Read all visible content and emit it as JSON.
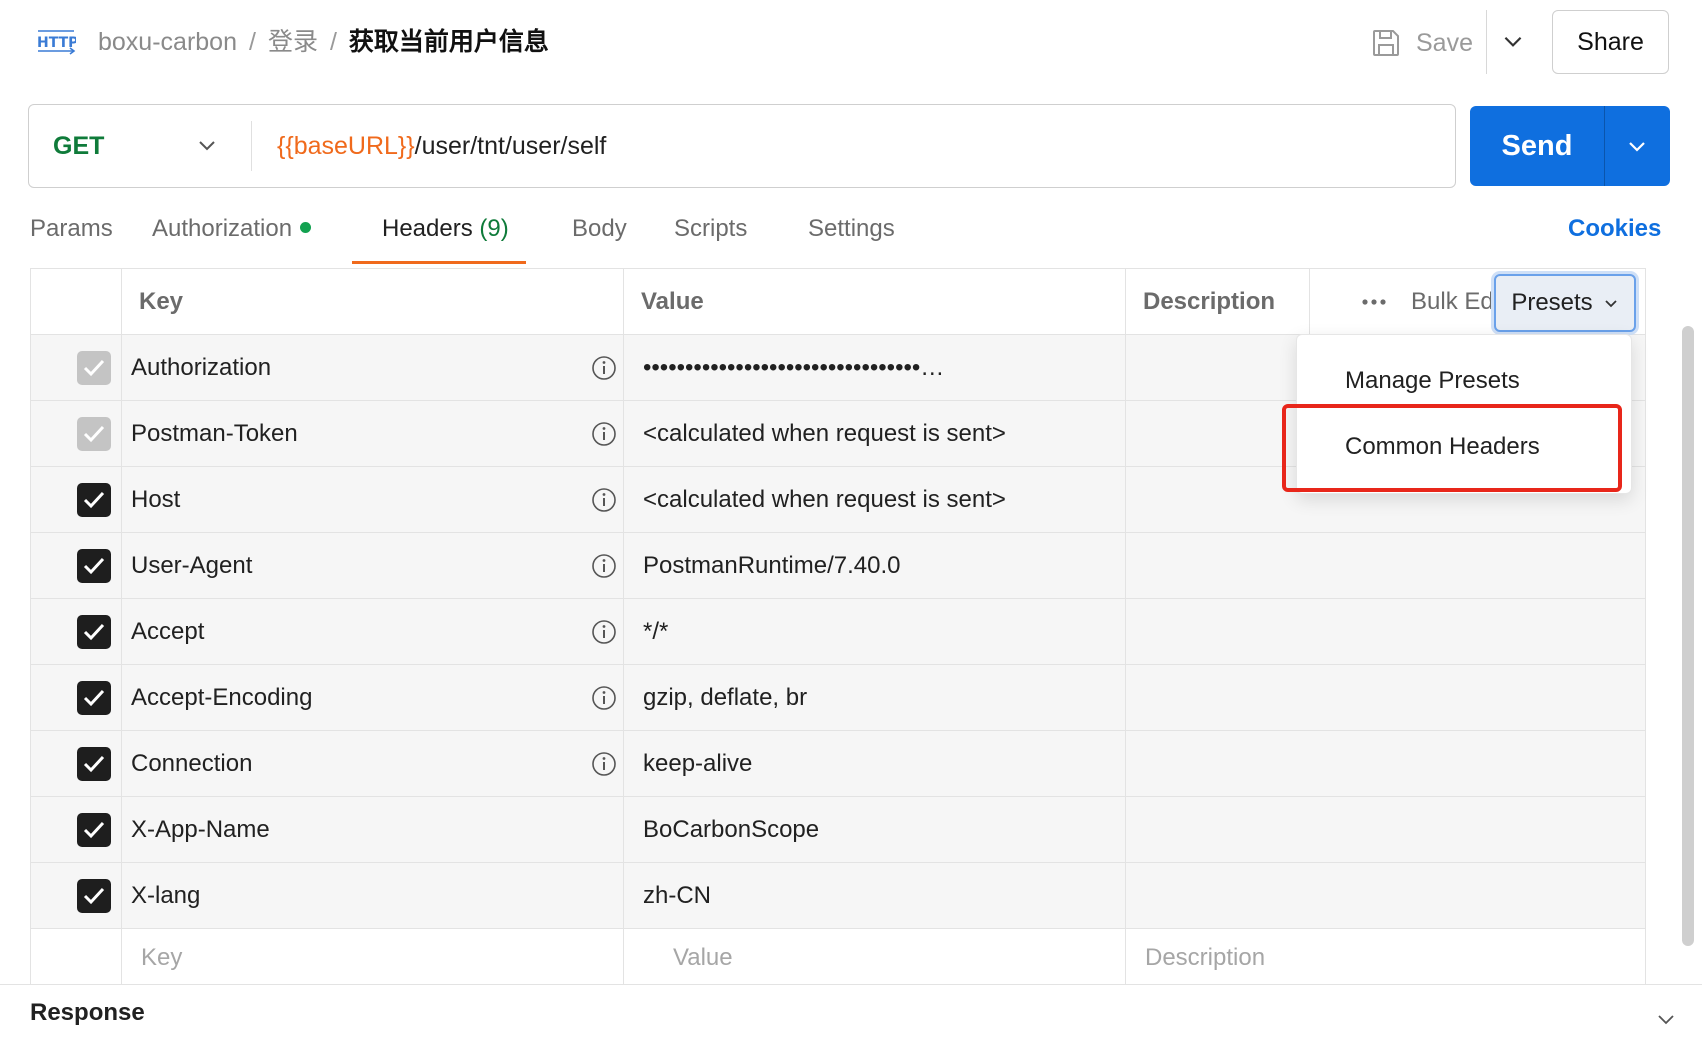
{
  "topbar": {
    "protocol_icon": "http-icon",
    "collection": "boxu-carbon",
    "folder": "登录",
    "separator": "/",
    "request_name": "获取当前用户信息",
    "save_label": "Save",
    "share_label": "Share"
  },
  "request": {
    "method": "GET",
    "url_variable": "{{baseURL}}",
    "url_path": "/user/tnt/user/self",
    "send_label": "Send"
  },
  "tabs": {
    "params": "Params",
    "authorization": "Authorization",
    "headers": "Headers",
    "headers_count": "(9)",
    "body": "Body",
    "scripts": "Scripts",
    "settings": "Settings",
    "active": "Headers",
    "cookies": "Cookies"
  },
  "table": {
    "columns": {
      "key": "Key",
      "value": "Value",
      "description": "Description"
    },
    "bulk_edit": "Bulk Edit",
    "presets": "Presets",
    "rows": [
      {
        "key": "Authorization",
        "value": "•••••••••••••••••••••••••••••••••…",
        "checked": true,
        "auto": true,
        "info": true
      },
      {
        "key": "Postman-Token",
        "value": "<calculated when request is sent>",
        "checked": true,
        "auto": true,
        "info": true
      },
      {
        "key": "Host",
        "value": "<calculated when request is sent>",
        "checked": true,
        "auto": false,
        "info": true
      },
      {
        "key": "User-Agent",
        "value": "PostmanRuntime/7.40.0",
        "checked": true,
        "auto": false,
        "info": true
      },
      {
        "key": "Accept",
        "value": "*/*",
        "checked": true,
        "auto": false,
        "info": true
      },
      {
        "key": "Accept-Encoding",
        "value": "gzip, deflate, br",
        "checked": true,
        "auto": false,
        "info": true
      },
      {
        "key": "Connection",
        "value": "keep-alive",
        "checked": true,
        "auto": false,
        "info": true
      },
      {
        "key": "X-App-Name",
        "value": "BoCarbonScope",
        "checked": true,
        "auto": false,
        "info": false
      },
      {
        "key": "X-lang",
        "value": "zh-CN",
        "checked": true,
        "auto": false,
        "info": false
      }
    ],
    "placeholders": {
      "key": "Key",
      "value": "Value",
      "description": "Description"
    }
  },
  "presets_menu": {
    "items": [
      "Manage Presets",
      "Common Headers"
    ],
    "highlighted": "Common Headers",
    "highlight_color": "#e8261a"
  },
  "response": {
    "label": "Response"
  },
  "colors": {
    "accent": "#0f6fdf",
    "method_get": "#0f7b3a",
    "url_variable": "#f06a1c",
    "active_tab_underline": "#f06a1c"
  }
}
